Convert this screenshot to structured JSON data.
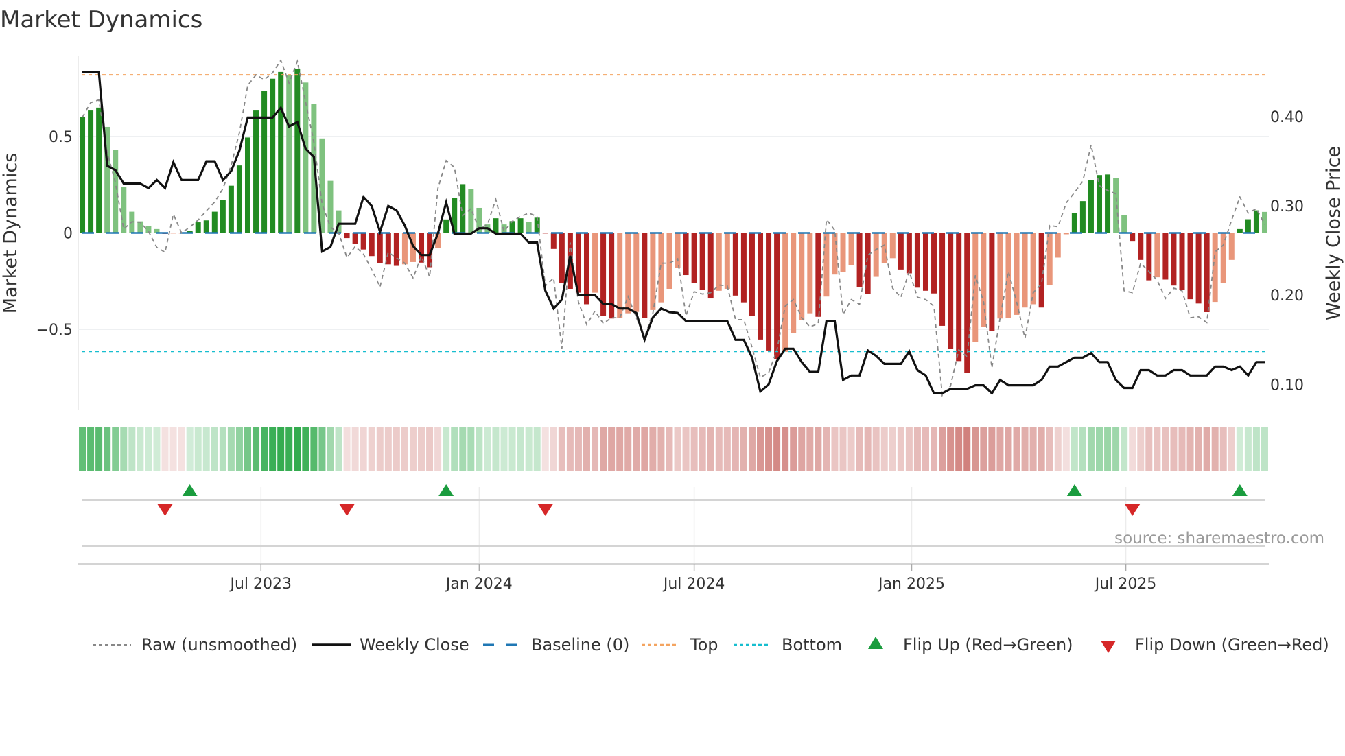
{
  "title": "Market Dynamics",
  "source": "source: sharemaestro.com",
  "colors": {
    "bar_up_strong": "#228b22",
    "bar_up_weak": "#7fc27f",
    "bar_down_strong": "#b22222",
    "bar_down_weak": "#e9967a",
    "raw": "#888888",
    "close": "#111111",
    "baseline": "#1f77b4",
    "top": "#f4a460",
    "bottom": "#17becf",
    "flip_up": "#1a9c3e",
    "flip_down": "#d62728",
    "heat_green": "40,167,69",
    "heat_red": "200,105,100"
  },
  "legend": {
    "raw": "Raw (unsmoothed)",
    "close": "Weekly Close",
    "baseline": "Baseline (0)",
    "top": "Top",
    "bottom": "Bottom",
    "flip_up": "Flip Up (Red→Green)",
    "flip_down": "Flip Down (Green→Red)"
  },
  "chart_data": {
    "type": "bar",
    "title": "Market Dynamics",
    "ylabel": "Market Dynamics",
    "y2label": "Weekly Close Price",
    "ylim": [
      -0.92,
      0.92
    ],
    "y2lim": [
      0.071,
      0.4685
    ],
    "yticks": [
      {
        "value": 0.5,
        "label": "0.5"
      },
      {
        "value": 0,
        "label": "0"
      },
      {
        "value": -0.5,
        "label": "−0.5"
      }
    ],
    "y2ticks": [
      {
        "value": 0.4,
        "label": "0.40"
      },
      {
        "value": 0.3,
        "label": "0.30"
      },
      {
        "value": 0.2,
        "label": "0.20"
      },
      {
        "value": 0.1,
        "label": "0.10"
      }
    ],
    "xlim": [
      -0.5,
      143.5
    ],
    "xticks": [
      {
        "index": 21.6,
        "label": "Jul 2023"
      },
      {
        "index": 48.0,
        "label": "Jan 2024"
      },
      {
        "index": 74.0,
        "label": "Jul 2024"
      },
      {
        "index": 100.3,
        "label": "Jan 2025"
      },
      {
        "index": 126.2,
        "label": "Jul 2025"
      }
    ],
    "levels": {
      "top": 0.82,
      "bottom": -0.615,
      "baseline": 0
    },
    "smoothed": [
      0.6,
      0.635,
      0.65,
      0.55,
      0.43,
      0.24,
      0.11,
      0.06,
      0.035,
      0.02,
      -0.005,
      -0.003,
      -0.002,
      0.01,
      0.055,
      0.065,
      0.11,
      0.17,
      0.245,
      0.35,
      0.495,
      0.635,
      0.735,
      0.8,
      0.835,
      0.82,
      0.85,
      0.78,
      0.67,
      0.49,
      0.27,
      0.117,
      -0.027,
      -0.057,
      -0.086,
      -0.12,
      -0.157,
      -0.163,
      -0.171,
      -0.163,
      -0.151,
      -0.154,
      -0.178,
      -0.08,
      0.07,
      0.18,
      0.253,
      0.227,
      0.13,
      0.044,
      0.076,
      0.044,
      0.061,
      0.076,
      0.058,
      0.079,
      -0.003,
      -0.083,
      -0.26,
      -0.29,
      -0.31,
      -0.37,
      -0.31,
      -0.43,
      -0.444,
      -0.44,
      -0.417,
      -0.41,
      -0.44,
      -0.4,
      -0.36,
      -0.29,
      -0.183,
      -0.219,
      -0.258,
      -0.297,
      -0.34,
      -0.3,
      -0.29,
      -0.325,
      -0.36,
      -0.43,
      -0.553,
      -0.61,
      -0.654,
      -0.617,
      -0.518,
      -0.453,
      -0.417,
      -0.435,
      -0.33,
      -0.216,
      -0.202,
      -0.169,
      -0.28,
      -0.317,
      -0.228,
      -0.155,
      -0.131,
      -0.19,
      -0.21,
      -0.284,
      -0.3,
      -0.314,
      -0.482,
      -0.6,
      -0.665,
      -0.727,
      -0.565,
      -0.486,
      -0.51,
      -0.444,
      -0.44,
      -0.425,
      -0.387,
      -0.37,
      -0.387,
      -0.272,
      -0.128,
      -0.007,
      0.105,
      0.165,
      0.274,
      0.3,
      0.303,
      0.283,
      0.091,
      -0.045,
      -0.14,
      -0.246,
      -0.23,
      -0.242,
      -0.273,
      -0.295,
      -0.344,
      -0.366,
      -0.411,
      -0.358,
      -0.261,
      -0.14,
      0.02,
      0.071,
      0.117,
      0.109
    ],
    "strong": [
      1,
      1,
      1,
      0,
      0,
      0,
      0,
      0,
      0,
      0,
      1,
      0,
      0,
      1,
      1,
      1,
      1,
      1,
      1,
      1,
      1,
      1,
      1,
      1,
      1,
      0,
      1,
      0,
      0,
      0,
      0,
      0,
      1,
      1,
      1,
      1,
      1,
      1,
      1,
      0,
      0,
      1,
      1,
      0,
      1,
      1,
      1,
      0,
      0,
      0,
      1,
      0,
      1,
      1,
      0,
      1,
      1,
      1,
      1,
      1,
      1,
      1,
      0,
      1,
      1,
      0,
      0,
      0,
      1,
      0,
      0,
      0,
      0,
      1,
      1,
      1,
      1,
      0,
      0,
      1,
      1,
      1,
      1,
      1,
      1,
      0,
      0,
      0,
      0,
      1,
      0,
      0,
      0,
      0,
      1,
      1,
      0,
      0,
      0,
      1,
      1,
      1,
      1,
      1,
      1,
      1,
      1,
      1,
      0,
      0,
      1,
      0,
      0,
      0,
      0,
      0,
      1,
      0,
      0,
      0,
      1,
      1,
      1,
      1,
      1,
      0,
      0,
      1,
      1,
      1,
      0,
      1,
      1,
      1,
      1,
      1,
      1,
      0,
      0,
      0,
      1,
      1,
      1,
      0
    ],
    "raw": [
      0.6,
      0.676,
      0.69,
      0.42,
      0.26,
      0.02,
      0.058,
      0.055,
      0.008,
      -0.075,
      -0.1,
      0.097,
      0,
      0.03,
      0.067,
      0.115,
      0.16,
      0.23,
      0.35,
      0.52,
      0.765,
      0.82,
      0.795,
      0.83,
      0.895,
      0.777,
      0.89,
      0.68,
      0.47,
      0.15,
      0.03,
      0,
      -0.128,
      -0.07,
      -0.11,
      -0.19,
      -0.28,
      -0.1,
      -0.13,
      -0.157,
      -0.234,
      -0.12,
      -0.228,
      0.23,
      0.375,
      0.34,
      0.09,
      0.126,
      0.02,
      0.044,
      0.174,
      0.008,
      0.061,
      0.085,
      0.103,
      0.085,
      -0.275,
      -0.234,
      -0.6,
      -0.05,
      -0.358,
      -0.476,
      -0.405,
      -0.47,
      -0.44,
      -0.44,
      -0.33,
      -0.44,
      -0.54,
      -0.417,
      -0.157,
      -0.157,
      -0.134,
      -0.43,
      -0.305,
      -0.317,
      -0.31,
      -0.27,
      -0.275,
      -0.45,
      -0.45,
      -0.595,
      -0.75,
      -0.725,
      -0.61,
      -0.38,
      -0.346,
      -0.44,
      -0.488,
      -0.47,
      0.07,
      0.014,
      -0.423,
      -0.346,
      -0.37,
      -0.116,
      -0.086,
      -0.063,
      -0.287,
      -0.334,
      -0.2,
      -0.334,
      -0.346,
      -0.38,
      -0.843,
      -0.795,
      -0.606,
      -0.642,
      -0.22,
      -0.358,
      -0.7,
      -0.44,
      -0.2,
      -0.358,
      -0.547,
      -0.31,
      -0.264,
      0.038,
      0.032,
      0.156,
      0.21,
      0.268,
      0.457,
      0.245,
      0.22,
      0.203,
      -0.3,
      -0.31,
      -0.157,
      -0.2,
      -0.246,
      -0.34,
      -0.287,
      -0.3,
      -0.44,
      -0.435,
      -0.465,
      -0.098,
      -0.063,
      0.067,
      0.186,
      0.103,
      0.126,
      0.044
    ],
    "close": [
      0.45,
      0.45,
      0.45,
      0.345,
      0.34,
      0.325,
      0.325,
      0.325,
      0.32,
      0.329,
      0.32,
      0.349,
      0.329,
      0.329,
      0.329,
      0.35,
      0.35,
      0.329,
      0.339,
      0.362,
      0.399,
      0.399,
      0.399,
      0.399,
      0.41,
      0.389,
      0.394,
      0.364,
      0.355,
      0.249,
      0.254,
      0.28,
      0.28,
      0.28,
      0.31,
      0.3,
      0.271,
      0.3,
      0.295,
      0.278,
      0.255,
      0.245,
      0.245,
      0.269,
      0.304,
      0.269,
      0.269,
      0.269,
      0.275,
      0.275,
      0.269,
      0.269,
      0.269,
      0.269,
      0.259,
      0.259,
      0.205,
      0.185,
      0.195,
      0.244,
      0.2,
      0.2,
      0.2,
      0.19,
      0.19,
      0.185,
      0.185,
      0.18,
      0.15,
      0.175,
      0.185,
      0.181,
      0.18,
      0.171,
      0.171,
      0.171,
      0.171,
      0.171,
      0.171,
      0.15,
      0.15,
      0.13,
      0.092,
      0.1,
      0.126,
      0.14,
      0.14,
      0.125,
      0.114,
      0.114,
      0.171,
      0.171,
      0.105,
      0.11,
      0.11,
      0.138,
      0.132,
      0.123,
      0.123,
      0.123,
      0.137,
      0.116,
      0.11,
      0.09,
      0.09,
      0.095,
      0.095,
      0.095,
      0.099,
      0.099,
      0.09,
      0.105,
      0.099,
      0.099,
      0.099,
      0.099,
      0.105,
      0.12,
      0.12,
      0.125,
      0.13,
      0.13,
      0.135,
      0.125,
      0.125,
      0.105,
      0.096,
      0.096,
      0.116,
      0.116,
      0.11,
      0.11,
      0.116,
      0.116,
      0.11,
      0.11,
      0.11,
      0.12,
      0.12,
      0.116,
      0.12,
      0.11,
      0.125,
      0.125
    ],
    "flip_up_index": [
      13,
      44,
      120,
      140
    ],
    "flip_down_index": [
      10,
      32,
      56,
      127
    ]
  }
}
